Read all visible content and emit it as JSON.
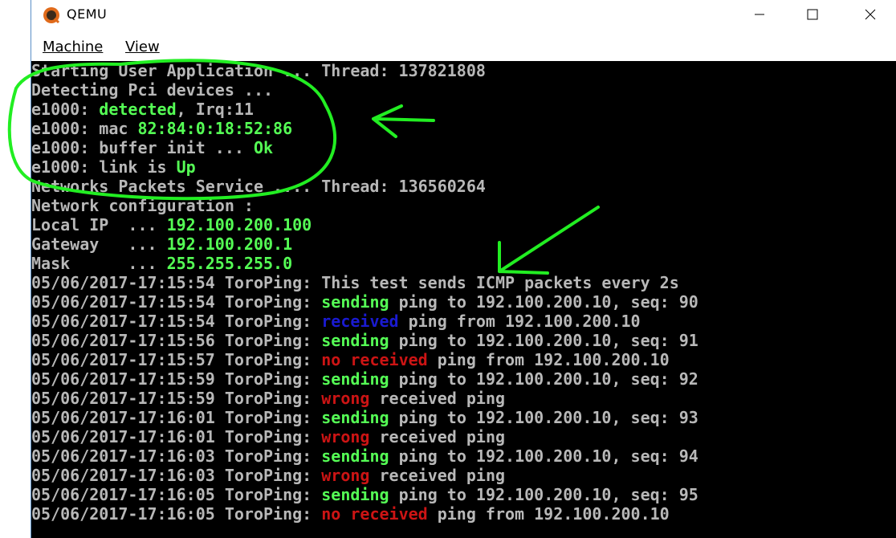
{
  "window": {
    "title": "QEMU"
  },
  "menu": {
    "machine_label": "Machine",
    "view_label": "View"
  },
  "colors": {
    "console_bg": "#000000",
    "console_text": "#b8b8b8",
    "ok_green": "#55ff55",
    "received_blue": "#1a1ad0",
    "error_red": "#cc1414",
    "annotation_green": "#22ee22"
  },
  "icons": {
    "app": "qemu-logo-icon",
    "minimize": "minimize-icon",
    "maximize": "maximize-icon",
    "close": "close-icon"
  },
  "console": {
    "lines": [
      {
        "segments": [
          {
            "t": "Starting User Application ... Thread: 137821808",
            "c": "grey"
          }
        ]
      },
      {
        "segments": [
          {
            "t": "Detecting Pci devices ...",
            "c": "grey"
          }
        ]
      },
      {
        "segments": [
          {
            "t": "e1000: ",
            "c": "grey"
          },
          {
            "t": "detected",
            "c": "green"
          },
          {
            "t": ", Irq:11",
            "c": "grey"
          }
        ]
      },
      {
        "segments": [
          {
            "t": "e1000: mac ",
            "c": "grey"
          },
          {
            "t": "82:84:0:18:52:86",
            "c": "green"
          }
        ]
      },
      {
        "segments": [
          {
            "t": "e1000: buffer init ... ",
            "c": "grey"
          },
          {
            "t": "Ok",
            "c": "green"
          }
        ]
      },
      {
        "segments": [
          {
            "t": "e1000: link is ",
            "c": "grey"
          },
          {
            "t": "Up",
            "c": "green"
          }
        ]
      },
      {
        "segments": [
          {
            "t": "Networks Packets Service .... Thread: 136560264",
            "c": "grey"
          }
        ]
      },
      {
        "segments": [
          {
            "t": "Network configuration :",
            "c": "grey"
          }
        ]
      },
      {
        "segments": [
          {
            "t": "Local IP  ... ",
            "c": "grey"
          },
          {
            "t": "192.100.200.100",
            "c": "green"
          }
        ]
      },
      {
        "segments": [
          {
            "t": "Gateway   ... ",
            "c": "grey"
          },
          {
            "t": "192.100.200.1",
            "c": "green"
          }
        ]
      },
      {
        "segments": [
          {
            "t": "Mask      ... ",
            "c": "grey"
          },
          {
            "t": "255.255.255.0",
            "c": "green"
          }
        ]
      },
      {
        "segments": [
          {
            "t": "05/06/2017-17:15:54 ToroPing: This test sends ICMP packets every 2s",
            "c": "grey"
          }
        ]
      },
      {
        "segments": [
          {
            "t": "05/06/2017-17:15:54 ToroPing: ",
            "c": "grey"
          },
          {
            "t": "sending",
            "c": "green"
          },
          {
            "t": " ping to 192.100.200.10, seq: 90",
            "c": "grey"
          }
        ]
      },
      {
        "segments": [
          {
            "t": "05/06/2017-17:15:54 ToroPing: ",
            "c": "grey"
          },
          {
            "t": "received",
            "c": "blue"
          },
          {
            "t": " ping from 192.100.200.10",
            "c": "grey"
          }
        ]
      },
      {
        "segments": [
          {
            "t": "05/06/2017-17:15:56 ToroPing: ",
            "c": "grey"
          },
          {
            "t": "sending",
            "c": "green"
          },
          {
            "t": " ping to 192.100.200.10, seq: 91",
            "c": "grey"
          }
        ]
      },
      {
        "segments": [
          {
            "t": "05/06/2017-17:15:57 ToroPing: ",
            "c": "grey"
          },
          {
            "t": "no received",
            "c": "red"
          },
          {
            "t": " ping from 192.100.200.10",
            "c": "grey"
          }
        ]
      },
      {
        "segments": [
          {
            "t": "05/06/2017-17:15:59 ToroPing: ",
            "c": "grey"
          },
          {
            "t": "sending",
            "c": "green"
          },
          {
            "t": " ping to 192.100.200.10, seq: 92",
            "c": "grey"
          }
        ]
      },
      {
        "segments": [
          {
            "t": "05/06/2017-17:15:59 ToroPing: ",
            "c": "grey"
          },
          {
            "t": "wrong",
            "c": "red"
          },
          {
            "t": " received ping",
            "c": "grey"
          }
        ]
      },
      {
        "segments": [
          {
            "t": "05/06/2017-17:16:01 ToroPing: ",
            "c": "grey"
          },
          {
            "t": "sending",
            "c": "green"
          },
          {
            "t": " ping to 192.100.200.10, seq: 93",
            "c": "grey"
          }
        ]
      },
      {
        "segments": [
          {
            "t": "05/06/2017-17:16:01 ToroPing: ",
            "c": "grey"
          },
          {
            "t": "wrong",
            "c": "red"
          },
          {
            "t": " received ping",
            "c": "grey"
          }
        ]
      },
      {
        "segments": [
          {
            "t": "05/06/2017-17:16:03 ToroPing: ",
            "c": "grey"
          },
          {
            "t": "sending",
            "c": "green"
          },
          {
            "t": " ping to 192.100.200.10, seq: 94",
            "c": "grey"
          }
        ]
      },
      {
        "segments": [
          {
            "t": "05/06/2017-17:16:03 ToroPing: ",
            "c": "grey"
          },
          {
            "t": "wrong",
            "c": "red"
          },
          {
            "t": " received ping",
            "c": "grey"
          }
        ]
      },
      {
        "segments": [
          {
            "t": "05/06/2017-17:16:05 ToroPing: ",
            "c": "grey"
          },
          {
            "t": "sending",
            "c": "green"
          },
          {
            "t": " ping to 192.100.200.10, seq: 95",
            "c": "grey"
          }
        ]
      },
      {
        "segments": [
          {
            "t": "05/06/2017-17:16:05 ToroPing: ",
            "c": "grey"
          },
          {
            "t": "no received",
            "c": "red"
          },
          {
            "t": " ping from 192.100.200.10",
            "c": "grey"
          }
        ]
      }
    ]
  }
}
